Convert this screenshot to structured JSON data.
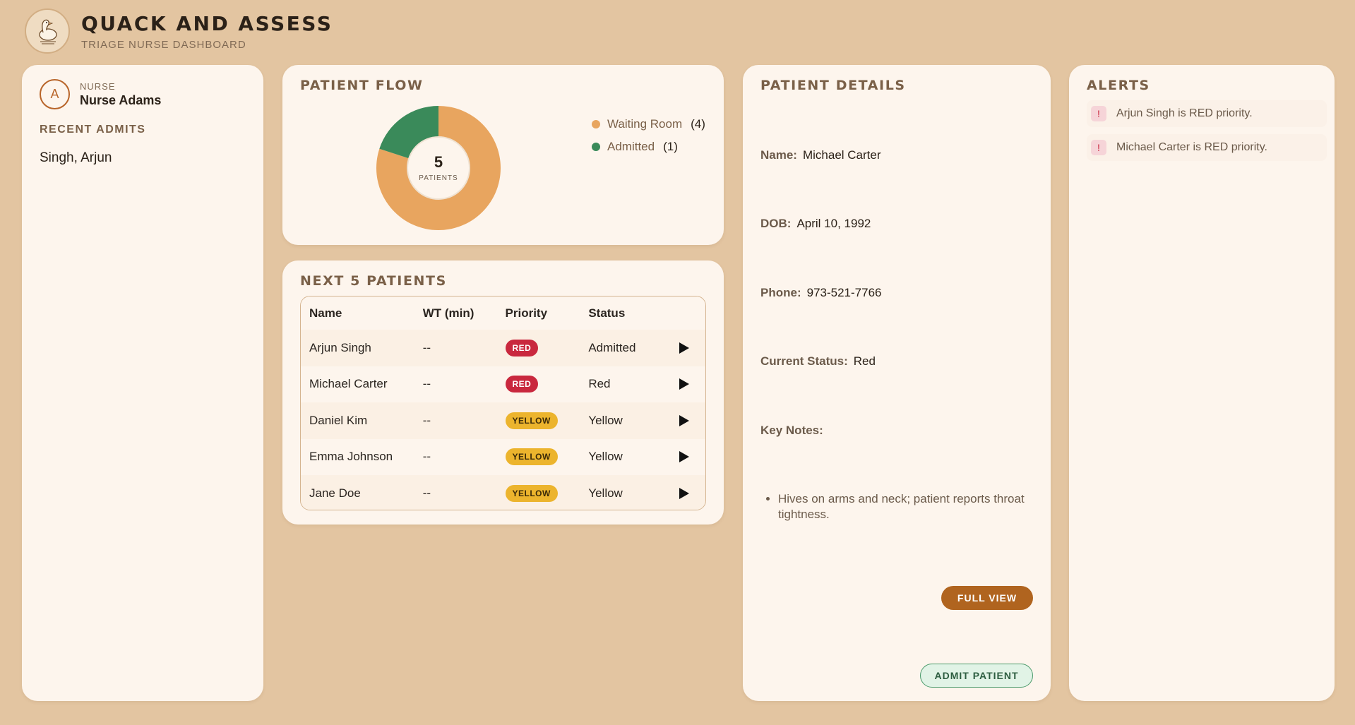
{
  "app": {
    "title": "QUACK AND ASSESS",
    "subtitle": "TRIAGE NURSE DASHBOARD",
    "logo_icon": "duck-logo-icon"
  },
  "nurse": {
    "avatar_initial": "A",
    "role": "NURSE",
    "name": "Nurse Adams",
    "recent_admits_label": "RECENT ADMITS",
    "recent_admits": [
      "Singh, Arjun"
    ]
  },
  "patient_flow": {
    "title": "PATIENT FLOW",
    "total": "5",
    "total_unit": "PATIENTS",
    "legend": [
      {
        "label": "Waiting Room",
        "count": "(4)",
        "color": "#e8a55f"
      },
      {
        "label": "Admitted",
        "count": "(1)",
        "color": "#3a8a5a"
      }
    ]
  },
  "chart_data": {
    "type": "pie",
    "categories": [
      "Waiting Room",
      "Admitted"
    ],
    "values": [
      4,
      1
    ],
    "colors": [
      "#e8a55f",
      "#3a8a5a"
    ],
    "legend": "right"
  },
  "next_patients": {
    "title": "NEXT 5 PATIENTS",
    "columns": [
      "Name",
      "WT (min)",
      "Priority",
      "Status"
    ],
    "rows": [
      {
        "name": "Arjun Singh",
        "wt": "--",
        "priority": "RED",
        "status": "Admitted"
      },
      {
        "name": "Michael Carter",
        "wt": "--",
        "priority": "RED",
        "status": "Red"
      },
      {
        "name": "Daniel Kim",
        "wt": "--",
        "priority": "YELLOW",
        "status": "Yellow"
      },
      {
        "name": "Emma Johnson",
        "wt": "--",
        "priority": "YELLOW",
        "status": "Yellow"
      },
      {
        "name": "Jane Doe",
        "wt": "--",
        "priority": "YELLOW",
        "status": "Yellow"
      }
    ],
    "action_icon": "play-icon"
  },
  "details": {
    "title": "PATIENT DETAILS",
    "name_label": "Name:",
    "name": "Michael Carter",
    "dob_label": "DOB:",
    "dob": "April 10, 1992",
    "phone_label": "Phone:",
    "phone": "973-521-7766",
    "status_label": "Current Status:",
    "status": "Red",
    "notes_label": "Key Notes:",
    "notes": [
      "Hives on arms and neck; patient reports throat tightness."
    ],
    "full_view_label": "FULL VIEW",
    "admit_label": "ADMIT PATIENT"
  },
  "alerts": {
    "title": "ALERTS",
    "items": [
      {
        "icon": "!",
        "text": "Arjun Singh is RED priority."
      },
      {
        "icon": "!",
        "text": "Michael Carter is RED priority."
      }
    ]
  }
}
